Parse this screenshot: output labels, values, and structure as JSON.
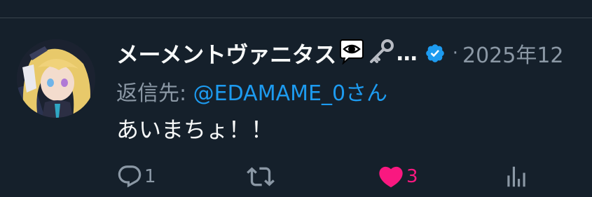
{
  "tweet": {
    "author_name": "メーメントヴァニタス",
    "name_emojis": [
      "eye-in-speech-bubble",
      "old-key"
    ],
    "name_truncation": "…",
    "separator": "·",
    "timestamp": "2025年12",
    "reply_to_prefix": "返信先: ",
    "reply_to_handle": "@EDAMAME_0",
    "reply_to_suffix": "さん",
    "text": "あいまちょ！！"
  },
  "actions": {
    "reply_count": "1",
    "like_count": "3",
    "liked": true
  },
  "colors": {
    "background": "#15202b",
    "accent": "#1d9bf0",
    "like": "#f91880",
    "secondary_text": "#8b98a5",
    "icon": "#8b98a5"
  }
}
